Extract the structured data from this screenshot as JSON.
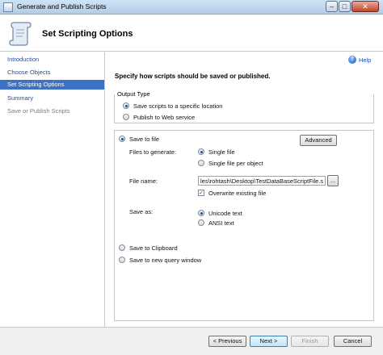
{
  "window": {
    "title": "Generate and Publish Scripts",
    "controls": {
      "minimize": "–",
      "maximize": "□",
      "close": "✕"
    }
  },
  "header": {
    "title": "Set Scripting Options",
    "icon": "scroll-icon"
  },
  "sidebar": {
    "items": [
      {
        "label": "Introduction",
        "state": "link"
      },
      {
        "label": "Choose Objects",
        "state": "link"
      },
      {
        "label": "Set Scripting Options",
        "state": "active"
      },
      {
        "label": "Summary",
        "state": "link"
      },
      {
        "label": "Save or Publish Scripts",
        "state": "disabled"
      }
    ]
  },
  "help": {
    "label": "Help",
    "icon": "help-icon",
    "glyph": "?"
  },
  "instruction": "Specify how scripts should be saved or published.",
  "output_type": {
    "legend": "Output Type",
    "options": [
      {
        "label": "Save scripts to a specific location",
        "selected": true
      },
      {
        "label": "Publish to Web service",
        "selected": false
      }
    ]
  },
  "save": {
    "save_to_file_label": "Save to file",
    "advanced_label": "Advanced",
    "files_to_generate": {
      "label": "Files to generate:",
      "options": [
        {
          "label": "Single file",
          "selected": true
        },
        {
          "label": "Single file per object",
          "selected": false
        }
      ]
    },
    "file_name": {
      "label": "File name:",
      "value": "les\\rohtash\\Desktop\\TestDataBaseScriptFile.sql",
      "browse_label": "..."
    },
    "overwrite": {
      "label": "Overwrite existing file",
      "checked": true,
      "glyph": "✓"
    },
    "save_as": {
      "label": "Save as:",
      "options": [
        {
          "label": "Unicode text",
          "selected": true
        },
        {
          "label": "ANSI text",
          "selected": false
        }
      ]
    },
    "clipboard_label": "Save to Clipboard",
    "query_window_label": "Save to new query window"
  },
  "footer": {
    "previous_label": "< Previous",
    "next_label": "Next >",
    "finish_label": "Finish",
    "cancel_label": "Cancel"
  }
}
